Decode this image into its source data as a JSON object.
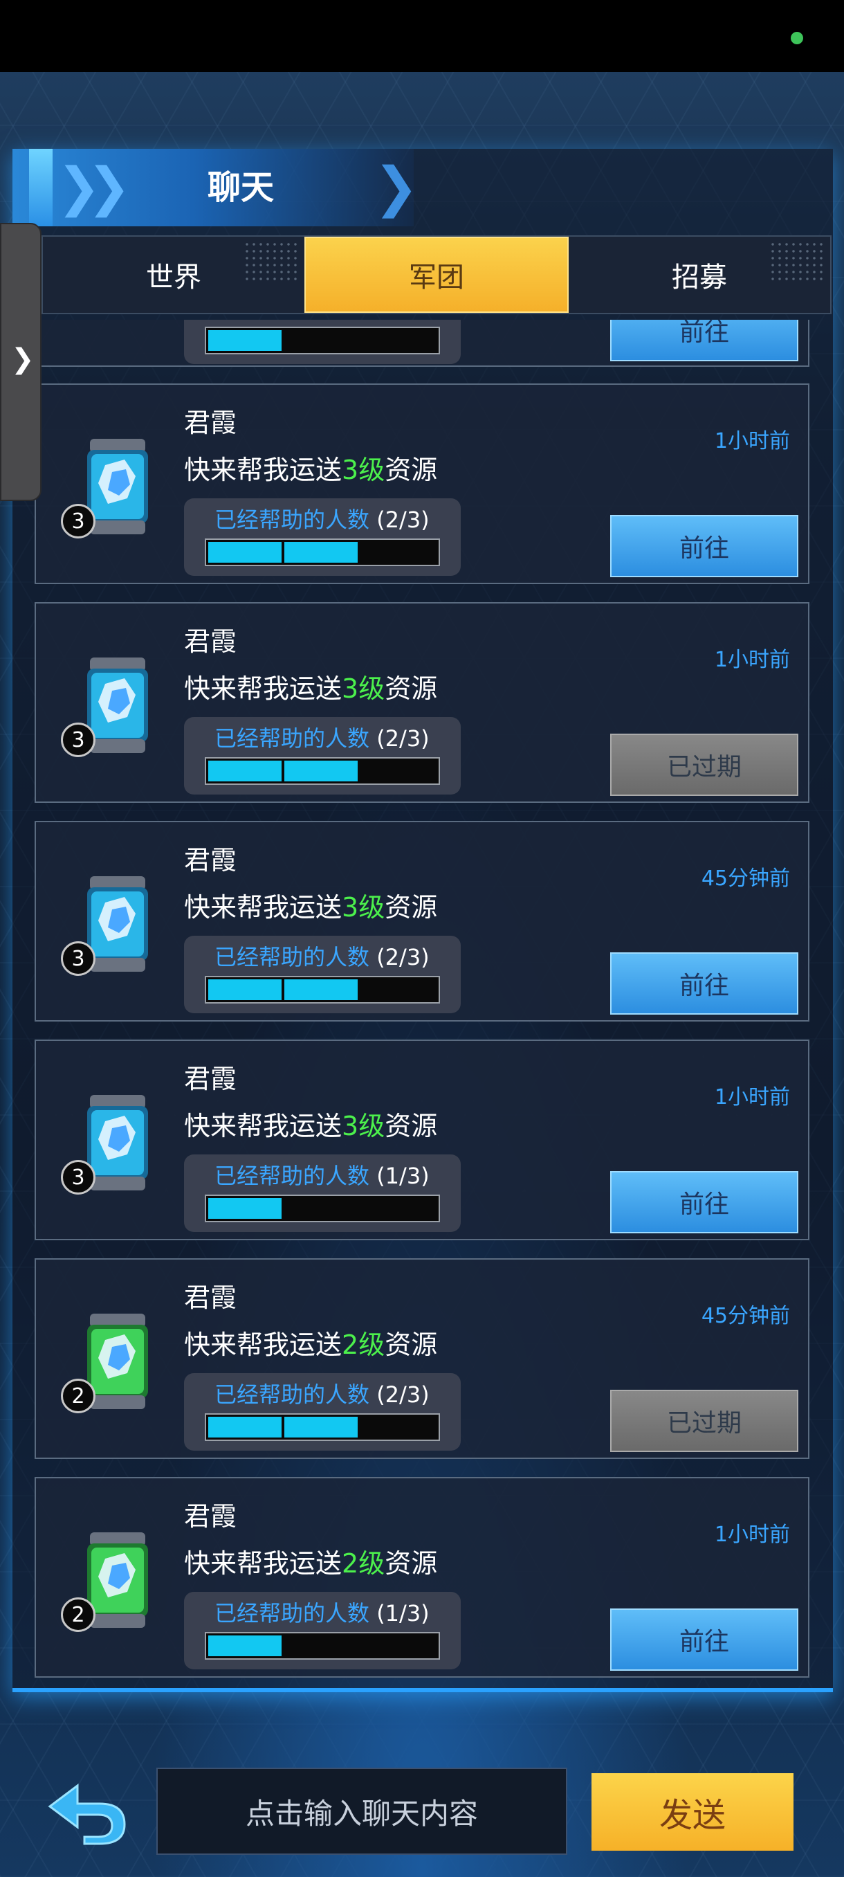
{
  "header": {
    "title": "聊天"
  },
  "tabs": [
    {
      "label": "世界",
      "active": false
    },
    {
      "label": "军团",
      "active": true
    },
    {
      "label": "招募",
      "active": false
    }
  ],
  "partial_card": {
    "button": "前往"
  },
  "cards": [
    {
      "sender": "君霞",
      "msg_prefix": "快来帮我运送",
      "level_text": "3级",
      "msg_suffix": "资源",
      "level": "3",
      "help_label": "已经帮助的人数",
      "help_count": "(2/3)",
      "progress": 0.67,
      "time": "1小时前",
      "button": "前往",
      "expired": false,
      "crystal_color": "blue"
    },
    {
      "sender": "君霞",
      "msg_prefix": "快来帮我运送",
      "level_text": "3级",
      "msg_suffix": "资源",
      "level": "3",
      "help_label": "已经帮助的人数",
      "help_count": "(2/3)",
      "progress": 0.67,
      "time": "1小时前",
      "button": "已过期",
      "expired": true,
      "crystal_color": "blue"
    },
    {
      "sender": "君霞",
      "msg_prefix": "快来帮我运送",
      "level_text": "3级",
      "msg_suffix": "资源",
      "level": "3",
      "help_label": "已经帮助的人数",
      "help_count": "(2/3)",
      "progress": 0.67,
      "time": "45分钟前",
      "button": "前往",
      "expired": false,
      "crystal_color": "blue"
    },
    {
      "sender": "君霞",
      "msg_prefix": "快来帮我运送",
      "level_text": "3级",
      "msg_suffix": "资源",
      "level": "3",
      "help_label": "已经帮助的人数",
      "help_count": "(1/3)",
      "progress": 0.33,
      "time": "1小时前",
      "button": "前往",
      "expired": false,
      "crystal_color": "blue"
    },
    {
      "sender": "君霞",
      "msg_prefix": "快来帮我运送",
      "level_text": "2级",
      "msg_suffix": "资源",
      "level": "2",
      "help_label": "已经帮助的人数",
      "help_count": "(2/3)",
      "progress": 0.67,
      "time": "45分钟前",
      "button": "已过期",
      "expired": true,
      "crystal_color": "green"
    },
    {
      "sender": "君霞",
      "msg_prefix": "快来帮我运送",
      "level_text": "2级",
      "msg_suffix": "资源",
      "level": "2",
      "help_label": "已经帮助的人数",
      "help_count": "(1/3)",
      "progress": 0.33,
      "time": "1小时前",
      "button": "前往",
      "expired": false,
      "crystal_color": "green"
    }
  ],
  "footer": {
    "input_placeholder": "点击输入聊天内容",
    "send_label": "发送"
  },
  "colors": {
    "accent_blue": "#3aa6ff",
    "progress_cyan": "#12c8f2",
    "level_green": "#4cf04c",
    "tab_active": "#f5b02a",
    "send_button": "#f6b128"
  },
  "icons": {
    "back": "back-arrow-icon",
    "drawer": "chevron-right-icon",
    "item": "resource-crystal-icon"
  }
}
